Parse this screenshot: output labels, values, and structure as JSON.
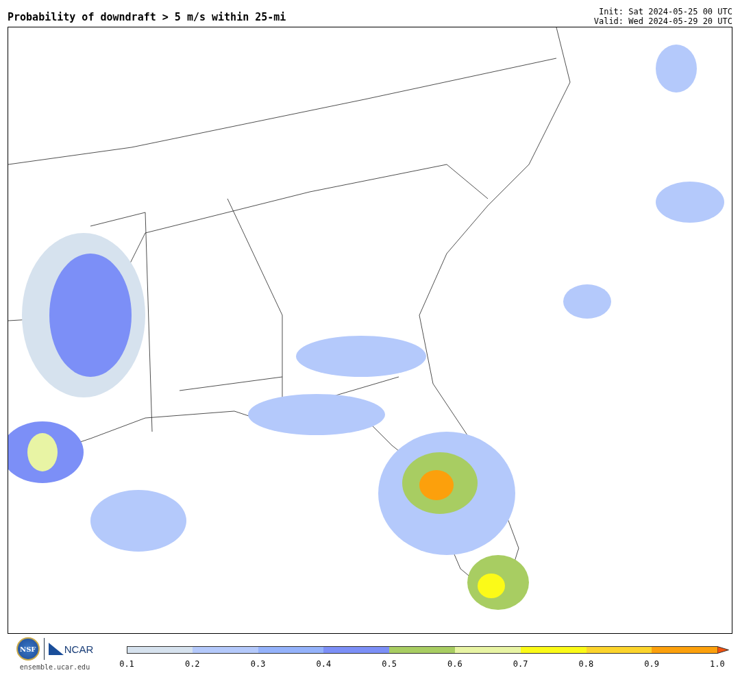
{
  "title": "Probability of downdraft > 5 m/s within 25-mi",
  "init": "Init: Sat 2024-05-25 00 UTC",
  "valid": "Valid: Wed 2024-05-29 20 UTC",
  "logos": {
    "nsf": "NSF",
    "ncar": "NCAR",
    "site": "ensemble.ucar.edu"
  },
  "colorbar": {
    "bins": [
      {
        "color": "#d6e2ee"
      },
      {
        "color": "#b4c9fb"
      },
      {
        "color": "#94b2fb"
      },
      {
        "color": "#7c8ff7"
      },
      {
        "color": "#a8cd62"
      },
      {
        "color": "#e8f4a4"
      },
      {
        "color": "#fbfa18"
      },
      {
        "color": "#fcd42c"
      },
      {
        "color": "#fca00c"
      }
    ],
    "extension": {
      "color": "#f2520e"
    },
    "ticks": [
      "0.1",
      "0.2",
      "0.3",
      "0.4",
      "0.5",
      "0.6",
      "0.7",
      "0.8",
      "0.9",
      "1.0"
    ]
  }
}
